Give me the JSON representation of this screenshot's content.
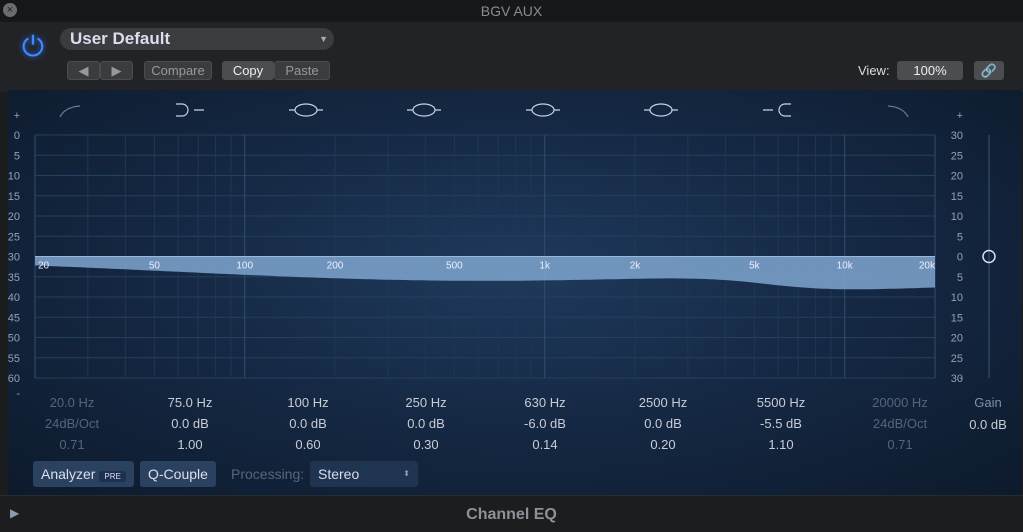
{
  "window": {
    "title": "BGV AUX",
    "close_icon": "close-icon"
  },
  "header": {
    "preset": "User Default",
    "prev": "◀",
    "next": "▶",
    "compare": "Compare",
    "copy": "Copy",
    "paste": "Paste",
    "view_label": "View:",
    "view_value": "100%",
    "link_icon": "link-icon",
    "power_icon": "power-icon",
    "power_color": "#3c8cff"
  },
  "graph": {
    "left_scale": [
      "+",
      "0",
      "5",
      "10",
      "15",
      "20",
      "25",
      "30",
      "35",
      "40",
      "45",
      "50",
      "55",
      "60",
      "-"
    ],
    "right_scale": [
      "+",
      "30",
      "25",
      "20",
      "15",
      "10",
      "5",
      "0",
      "5",
      "10",
      "15",
      "20",
      "25",
      "30",
      "-"
    ],
    "freq_labels": [
      "20",
      "50",
      "100",
      "200",
      "500",
      "1k",
      "2k",
      "5k",
      "10k",
      "20k"
    ],
    "freq_values": [
      20,
      50,
      100,
      200,
      500,
      1000,
      2000,
      5000,
      10000,
      20000
    ],
    "curve_color": "#7fa6cf",
    "db_range": 30
  },
  "bands": [
    {
      "type": "low-cut",
      "freq": "20.0 Hz",
      "gain": "24dB/Oct",
      "q": "0.71",
      "enabled": false,
      "f": 20,
      "g": 0
    },
    {
      "type": "low-shelf",
      "freq": "75.0 Hz",
      "gain": "0.0 dB",
      "q": "1.00",
      "enabled": true,
      "f": 75,
      "g": 0
    },
    {
      "type": "bell",
      "freq": "100 Hz",
      "gain": "0.0 dB",
      "q": "0.60",
      "enabled": true,
      "f": 100,
      "g": 0
    },
    {
      "type": "bell",
      "freq": "250 Hz",
      "gain": "0.0 dB",
      "q": "0.30",
      "enabled": true,
      "f": 250,
      "g": 0
    },
    {
      "type": "bell",
      "freq": "630 Hz",
      "gain": "-6.0 dB",
      "q": "0.14",
      "enabled": true,
      "f": 630,
      "g": -6
    },
    {
      "type": "bell",
      "freq": "2500 Hz",
      "gain": "0.0 dB",
      "q": "0.20",
      "enabled": true,
      "f": 2500,
      "g": 0
    },
    {
      "type": "high-shelf",
      "freq": "5500 Hz",
      "gain": "-5.5 dB",
      "q": "1.10",
      "enabled": true,
      "f": 5500,
      "g": -5.5
    },
    {
      "type": "high-cut",
      "freq": "20000 Hz",
      "gain": "24dB/Oct",
      "q": "0.71",
      "enabled": false,
      "f": 20000,
      "g": 0
    }
  ],
  "gain": {
    "label": "Gain",
    "value": "0.0 dB"
  },
  "footer": {
    "analyzer": "Analyzer",
    "pre": "PRE",
    "qcouple": "Q-Couple",
    "processing_label": "Processing:",
    "processing_value": "Stereo",
    "plugin_name": "Channel EQ"
  }
}
